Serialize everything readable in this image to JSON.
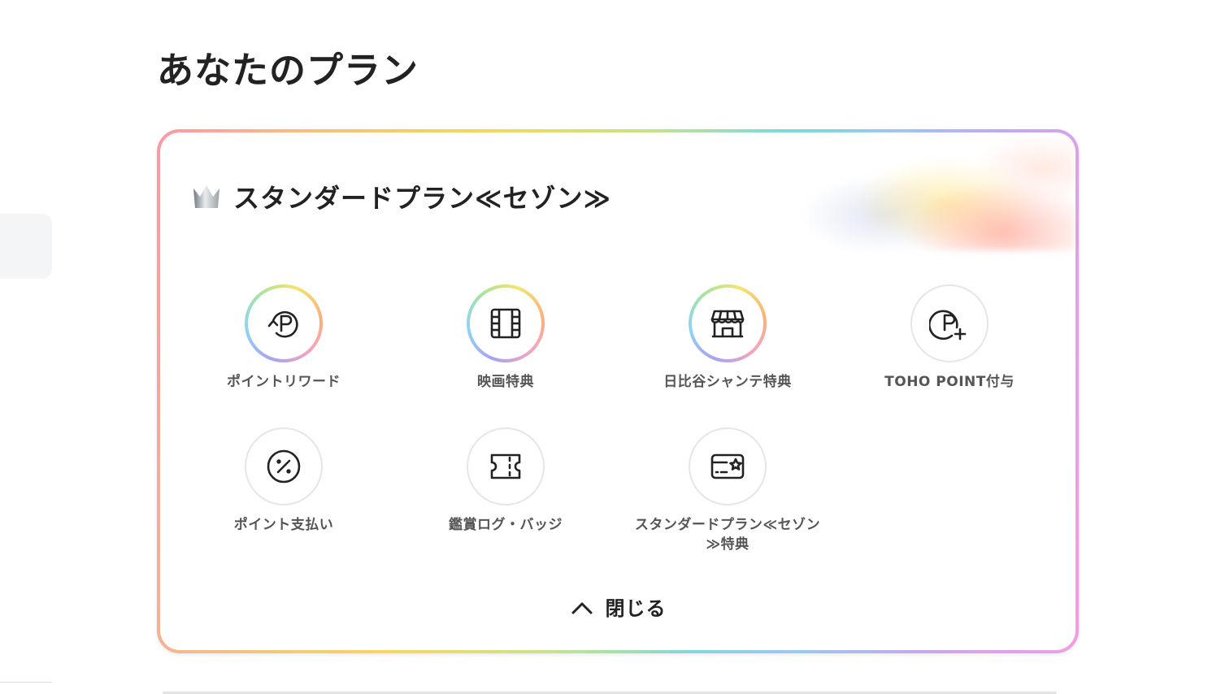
{
  "page": {
    "title": "あなたのプラン"
  },
  "plan": {
    "name": "スタンダードプラン≪セゾン≫",
    "crown_icon": "crown-icon",
    "border_gradient": [
      "#f59aa6",
      "#f4d85c",
      "#7ed9d8",
      "#c3a8f2",
      "#f59ce0"
    ],
    "benefits": [
      {
        "label": "ポイントリワード",
        "icon": "point-reward-icon",
        "style": "gradient"
      },
      {
        "label": "映画特典",
        "icon": "film-icon",
        "style": "gradient"
      },
      {
        "label": "日比谷シャンテ特典",
        "icon": "store-icon",
        "style": "gradient"
      },
      {
        "label": "TOHO POINT付与",
        "icon": "point-plus-icon",
        "style": "plain"
      },
      {
        "label": "ポイント支払い",
        "icon": "percent-icon",
        "style": "plain"
      },
      {
        "label": "鑑賞ログ・バッジ",
        "icon": "ticket-icon",
        "style": "plain"
      },
      {
        "label": "スタンダードプラン≪セゾン≫特典",
        "icon": "card-star-icon",
        "style": "plain"
      }
    ],
    "close_label": "閉じる",
    "close_icon": "chevron-up-icon"
  }
}
